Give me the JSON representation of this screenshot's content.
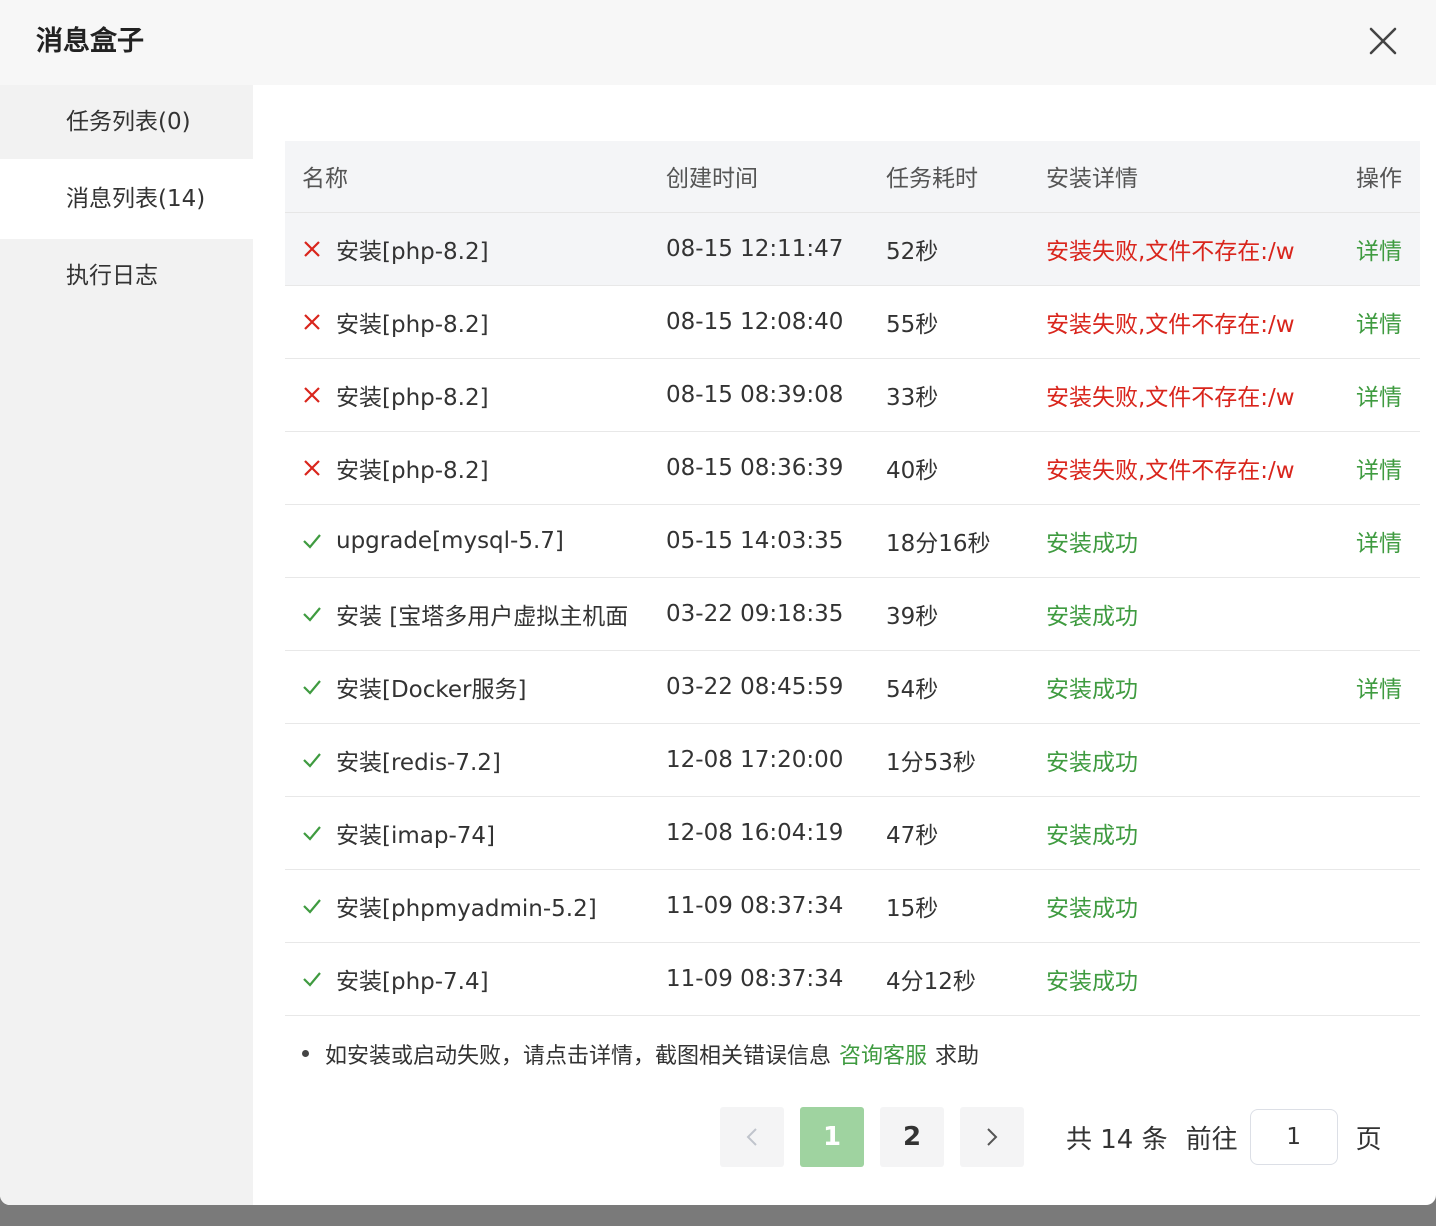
{
  "dialog": {
    "title": "消息盒子"
  },
  "sidebar": {
    "items": [
      {
        "label": "任务列表(0)"
      },
      {
        "label": "消息列表(14)"
      },
      {
        "label": "执行日志"
      }
    ]
  },
  "table": {
    "headers": [
      "名称",
      "创建时间",
      "任务耗时",
      "安装详情",
      "操作"
    ],
    "rows": [
      {
        "status": "fail",
        "name": "安装[php-8.2]",
        "time": "08-15 12:11:47",
        "duration": "52秒",
        "detail": "安装失败,文件不存在:/w",
        "action": "详情"
      },
      {
        "status": "fail",
        "name": "安装[php-8.2]",
        "time": "08-15 12:08:40",
        "duration": "55秒",
        "detail": "安装失败,文件不存在:/w",
        "action": "详情"
      },
      {
        "status": "fail",
        "name": "安装[php-8.2]",
        "time": "08-15 08:39:08",
        "duration": "33秒",
        "detail": "安装失败,文件不存在:/w",
        "action": "详情"
      },
      {
        "status": "fail",
        "name": "安装[php-8.2]",
        "time": "08-15 08:36:39",
        "duration": "40秒",
        "detail": "安装失败,文件不存在:/w",
        "action": "详情"
      },
      {
        "status": "ok",
        "name": "upgrade[mysql-5.7]",
        "time": "05-15 14:03:35",
        "duration": "18分16秒",
        "detail": "安装成功",
        "action": "详情"
      },
      {
        "status": "ok",
        "name": "安装 [宝塔多用户虚拟主机面",
        "time": "03-22 09:18:35",
        "duration": "39秒",
        "detail": "安装成功",
        "action": ""
      },
      {
        "status": "ok",
        "name": "安装[Docker服务]",
        "time": "03-22 08:45:59",
        "duration": "54秒",
        "detail": "安装成功",
        "action": "详情"
      },
      {
        "status": "ok",
        "name": "安装[redis-7.2]",
        "time": "12-08 17:20:00",
        "duration": "1分53秒",
        "detail": "安装成功",
        "action": ""
      },
      {
        "status": "ok",
        "name": "安装[imap-74]",
        "time": "12-08 16:04:19",
        "duration": "47秒",
        "detail": "安装成功",
        "action": ""
      },
      {
        "status": "ok",
        "name": "安装[phpmyadmin-5.2]",
        "time": "11-09 08:37:34",
        "duration": "15秒",
        "detail": "安装成功",
        "action": ""
      },
      {
        "status": "ok",
        "name": "安装[php-7.4]",
        "time": "11-09 08:37:34",
        "duration": "4分12秒",
        "detail": "安装成功",
        "action": ""
      }
    ]
  },
  "tip": {
    "before": "如安装或启动失败，请点击详情，截图相关错误信息",
    "link": "咨询客服",
    "after": "求助"
  },
  "pagination": {
    "pages": [
      "1",
      "2"
    ],
    "current": "1",
    "total_text": "共 14 条",
    "goto_label": "前往",
    "goto_value": "1",
    "page_unit": "页"
  },
  "icons": {
    "close": "close-icon",
    "fail": "cross-icon",
    "ok": "check-icon",
    "prev": "chevron-left-icon",
    "next": "chevron-right-icon"
  },
  "colors": {
    "fail": "#d9251c",
    "ok": "#3f9b40",
    "active_page": "#9fd3a0"
  }
}
